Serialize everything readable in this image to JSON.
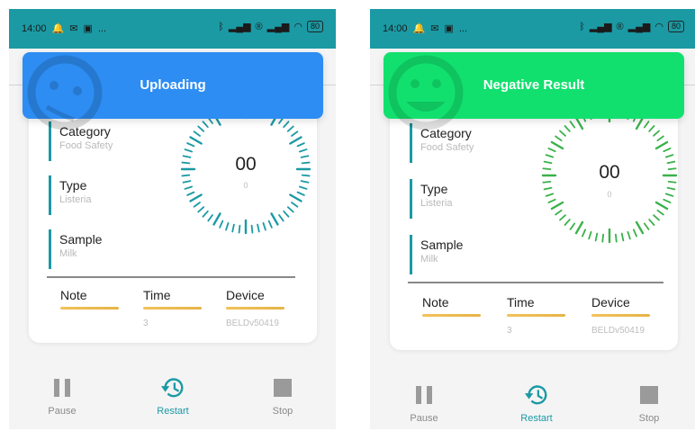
{
  "screens": [
    {
      "status": {
        "time": "14:00",
        "battery": "80",
        "extra": "..."
      },
      "banner": {
        "text": "Uploading",
        "color": "#2d8df2",
        "face_icon": "sad-face-icon"
      },
      "fields": [
        {
          "label": "Category",
          "value": "Food Safety"
        },
        {
          "label": "Type",
          "value": "Listeria"
        },
        {
          "label": "Sample",
          "value": "Milk"
        }
      ],
      "dial": {
        "count": "00",
        "sub": "0",
        "color": "#1b9aa4"
      },
      "columns": [
        {
          "header": "Note",
          "value": ""
        },
        {
          "header": "Time",
          "value": "3"
        },
        {
          "header": "Device",
          "value": "BELDv50419"
        }
      ],
      "controls": [
        {
          "label": "Pause",
          "icon": "pause-icon",
          "active": false
        },
        {
          "label": "Restart",
          "icon": "restart-icon",
          "active": true
        },
        {
          "label": "Stop",
          "icon": "stop-icon",
          "active": false
        }
      ]
    },
    {
      "status": {
        "time": "14:00",
        "battery": "80",
        "extra": "..."
      },
      "banner": {
        "text": "Negative Result",
        "color": "#12e06e",
        "face_icon": "happy-face-icon"
      },
      "fields": [
        {
          "label": "Category",
          "value": "Food Safety"
        },
        {
          "label": "Type",
          "value": "Listeria"
        },
        {
          "label": "Sample",
          "value": "Milk"
        }
      ],
      "dial": {
        "count": "00",
        "sub": "0",
        "color": "#3ab14a"
      },
      "columns": [
        {
          "header": "Note",
          "value": ""
        },
        {
          "header": "Time",
          "value": "3"
        },
        {
          "header": "Device",
          "value": "BELDv50419"
        }
      ],
      "controls": [
        {
          "label": "Pause",
          "icon": "pause-icon",
          "active": false
        },
        {
          "label": "Restart",
          "icon": "restart-icon",
          "active": true
        },
        {
          "label": "Stop",
          "icon": "stop-icon",
          "active": false
        }
      ]
    }
  ]
}
